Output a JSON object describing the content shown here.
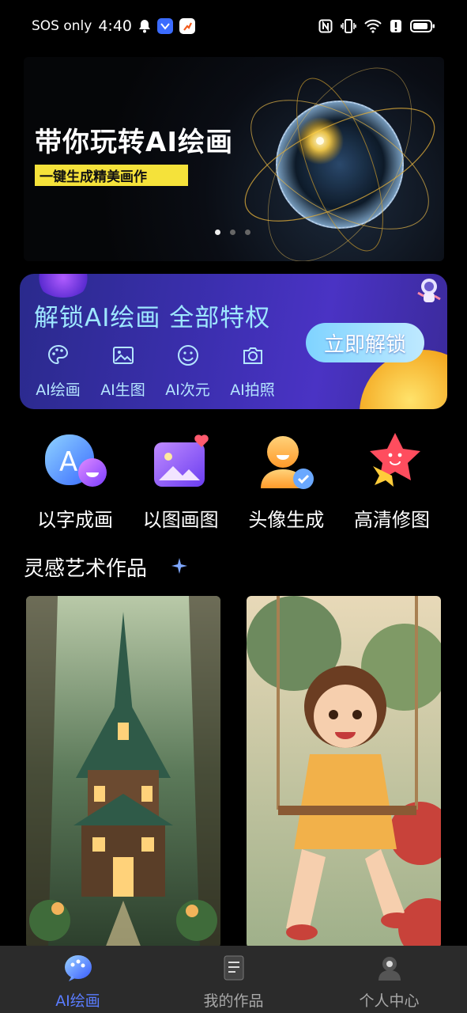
{
  "status_bar": {
    "carrier": "SOS only",
    "time": "4:40",
    "icons": [
      "bell-icon",
      "app-badge-blue-icon",
      "app-badge-orange-icon",
      "nfc-icon",
      "vibrate-icon",
      "wifi-icon",
      "alert-icon",
      "battery-icon"
    ]
  },
  "hero": {
    "title": "带你玩转AI绘画",
    "subtitle": "一键生成精美画作",
    "slides": 3,
    "active_slide": 0
  },
  "unlock": {
    "title": "解锁AI绘画 全部特权",
    "button": "立即解锁",
    "perks": [
      {
        "label": "AI绘画",
        "icon": "palette-icon"
      },
      {
        "label": "AI生图",
        "icon": "image-icon"
      },
      {
        "label": "AI次元",
        "icon": "smiley-icon"
      },
      {
        "label": "AI拍照",
        "icon": "camera-icon"
      }
    ]
  },
  "tools": [
    {
      "label": "以字成画",
      "icon": "text-to-image-icon"
    },
    {
      "label": "以图画图",
      "icon": "image-to-image-icon"
    },
    {
      "label": "头像生成",
      "icon": "avatar-generate-icon"
    },
    {
      "label": "高清修图",
      "icon": "hd-retouch-icon"
    }
  ],
  "section": {
    "title": "灵感艺术作品"
  },
  "nav": [
    {
      "label": "AI绘画",
      "icon": "ai-paint-nav-icon",
      "active": true
    },
    {
      "label": "我的作品",
      "icon": "my-works-nav-icon",
      "active": false
    },
    {
      "label": "个人中心",
      "icon": "profile-nav-icon",
      "active": false
    }
  ],
  "colors": {
    "accent": "#5a7cff",
    "unlock_title": "#9ee7ff",
    "hero_sub_bg": "#f5e23a"
  }
}
